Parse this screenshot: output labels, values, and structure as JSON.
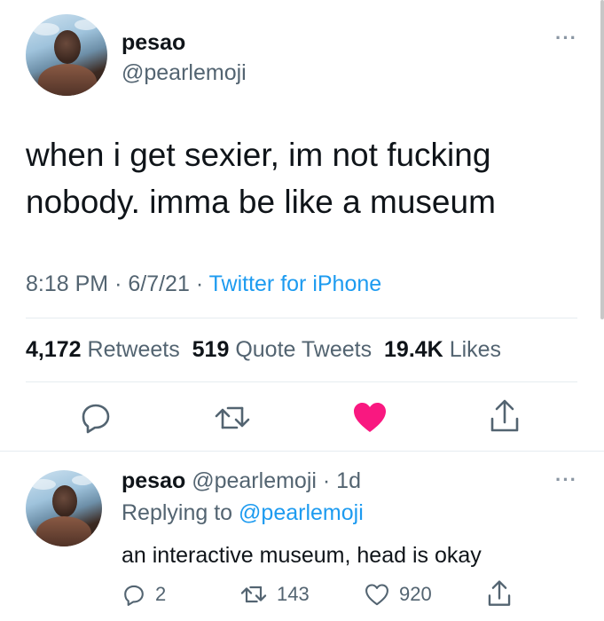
{
  "tweet": {
    "author_name": "pesao",
    "author_handle": "@pearlemoji",
    "more_label": "···",
    "text_line1": "when i get sexier, im not fucking",
    "text_line2": "nobody. imma be like a museum",
    "time": "8:18 PM",
    "date": "6/7/21",
    "separator": "·",
    "source": "Twitter for iPhone",
    "stats": {
      "retweets_count": "4,172",
      "retweets_label": "Retweets",
      "quotes_count": "519",
      "quotes_label": "Quote Tweets",
      "likes_count": "19.4K",
      "likes_label": "Likes"
    },
    "actions": {
      "reply_icon": "reply-icon",
      "retweet_icon": "retweet-icon",
      "like_icon": "heart-filled-icon",
      "share_icon": "share-icon",
      "liked": true,
      "like_color": "#f91880"
    }
  },
  "reply": {
    "author_name": "pesao",
    "author_handle": "@pearlemoji",
    "age": "· 1d",
    "more_label": "···",
    "replying_prefix": "Replying to",
    "replying_handle": "@pearlemoji",
    "text": "an interactive museum, head is okay",
    "replies_count": "2",
    "retweets_count": "143",
    "likes_count": "920"
  },
  "colors": {
    "link": "#1d9bf0",
    "secondary_text": "#536471",
    "primary_text": "#0f1419"
  }
}
